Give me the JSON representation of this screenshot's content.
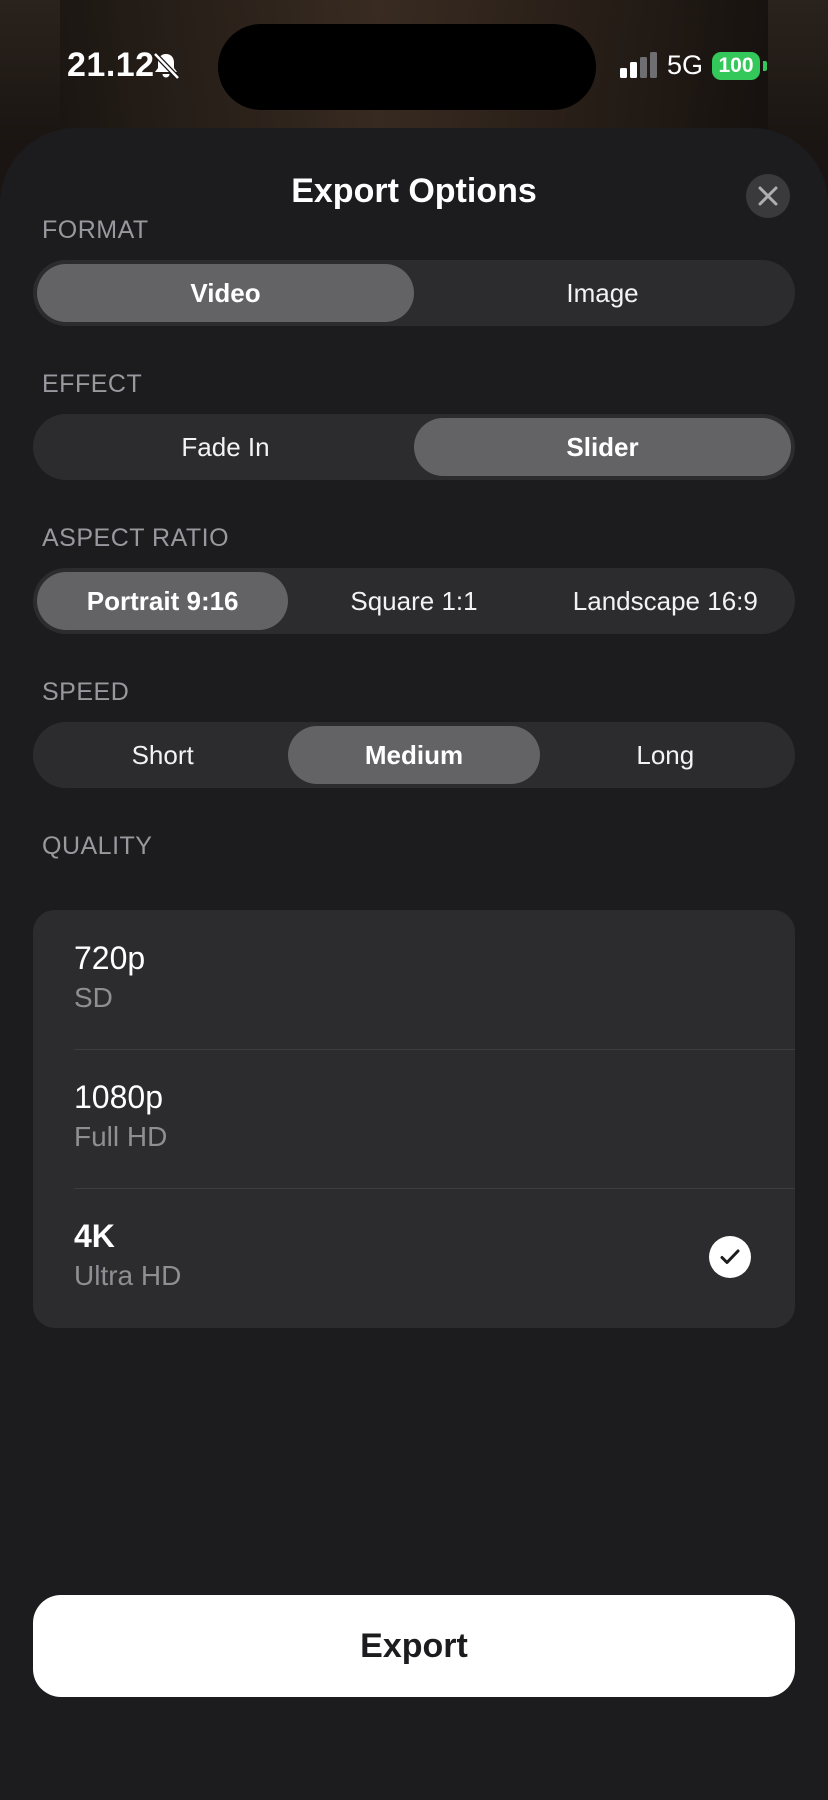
{
  "status_bar": {
    "time": "21.12",
    "network": "5G",
    "battery": "100",
    "icons": [
      "bell-slash-icon",
      "signal-icon"
    ]
  },
  "sheet": {
    "title": "Export Options",
    "close_icon": "close-icon"
  },
  "format": {
    "label": "FORMAT",
    "options": [
      "Video",
      "Image"
    ],
    "selected": "Video"
  },
  "effect": {
    "label": "EFFECT",
    "options": [
      "Fade In",
      "Slider"
    ],
    "selected": "Slider"
  },
  "aspect_ratio": {
    "label": "ASPECT RATIO",
    "options": [
      "Portrait 9:16",
      "Square 1:1",
      "Landscape 16:9"
    ],
    "selected": "Portrait 9:16"
  },
  "speed": {
    "label": "SPEED",
    "options": [
      "Short",
      "Medium",
      "Long"
    ],
    "selected": "Medium"
  },
  "quality": {
    "label": "QUALITY",
    "options": [
      {
        "title": "720p",
        "subtitle": "SD"
      },
      {
        "title": "1080p",
        "subtitle": "Full HD"
      },
      {
        "title": "4K",
        "subtitle": "Ultra HD"
      }
    ],
    "selected": "4K"
  },
  "export_label": "Export",
  "colors": {
    "sheet_bg": "#1c1c1e",
    "control_bg": "#2c2c2e",
    "selected_segment": "#636366",
    "battery_green": "#34c759",
    "primary_button": "#ffffff"
  }
}
